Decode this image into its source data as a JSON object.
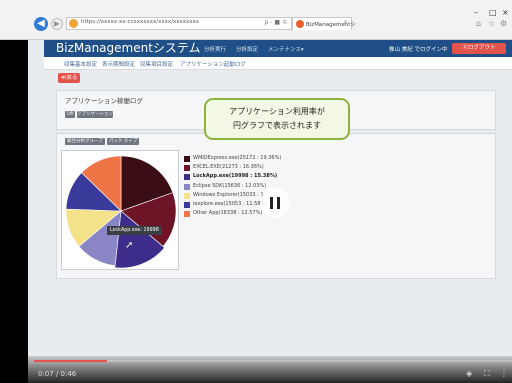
{
  "browser": {
    "url": "https://xxxxx-xx-ccxxxxxxx/xxxx/xxxxxxxx",
    "tab_title": "BizManagementシ",
    "search_hint": "ρ - ■ ©",
    "window_controls": [
      "–",
      "□",
      "×"
    ],
    "toolbar_icons": [
      "home-icon",
      "star-icon",
      "gear-icon"
    ]
  },
  "app": {
    "brand": "BizManagementシステム",
    "menu": [
      "分析実行",
      "分析設定",
      "メンテナンス▾"
    ],
    "user": "株山 美紀 でログイン中",
    "logout": "Ⓧログアウト"
  },
  "subnav": [
    "収集基本設定",
    "表示期間設定",
    "収集項目設定",
    "アプリケーション起動ログ"
  ],
  "back_button": "≪戻る",
  "section": {
    "title": "アプリケーション稼働ログ",
    "chips": [
      "1件",
      "アプリケーション一覧"
    ],
    "chart_chips": [
      "総合分析グループ",
      "パック タイプ"
    ]
  },
  "callout": {
    "line1": "アプリケーション利用率が",
    "line2": "円グラフで表示されます"
  },
  "chart_data": {
    "type": "pie",
    "slices": [
      {
        "label": "WMIDExpress.exe(25172 : 19.36%)",
        "value": 19.36,
        "color": "#3b0e16"
      },
      {
        "label": "EXCEL.EXE(21273 : 16.36%)",
        "value": 16.36,
        "color": "#6e1427"
      },
      {
        "label": "LockApp.exe(19998 : 15.38%)",
        "value": 15.38,
        "color": "#3d2c8a"
      },
      {
        "label": "Eclipse SDK(15636 : 12.03%)",
        "value": 12.03,
        "color": "#8a86c6"
      },
      {
        "label": "Windows Explorer(15033 : 1",
        "value": 11.56,
        "color": "#f3e289"
      },
      {
        "label": "iexplore.exe(15053 : 11.58%)",
        "value": 11.58,
        "color": "#3a3a9a"
      },
      {
        "label": "Other App(16338 : 12.57%)",
        "value": 12.57,
        "color": "#ef7446"
      }
    ],
    "highlight_index": 2,
    "tooltip": "LockApp.exe: 19998"
  },
  "video": {
    "time": "0:07 / 0:46",
    "progress": 0.152,
    "icons": [
      "volume-icon",
      "fullscreen-icon",
      "more-icon"
    ]
  }
}
